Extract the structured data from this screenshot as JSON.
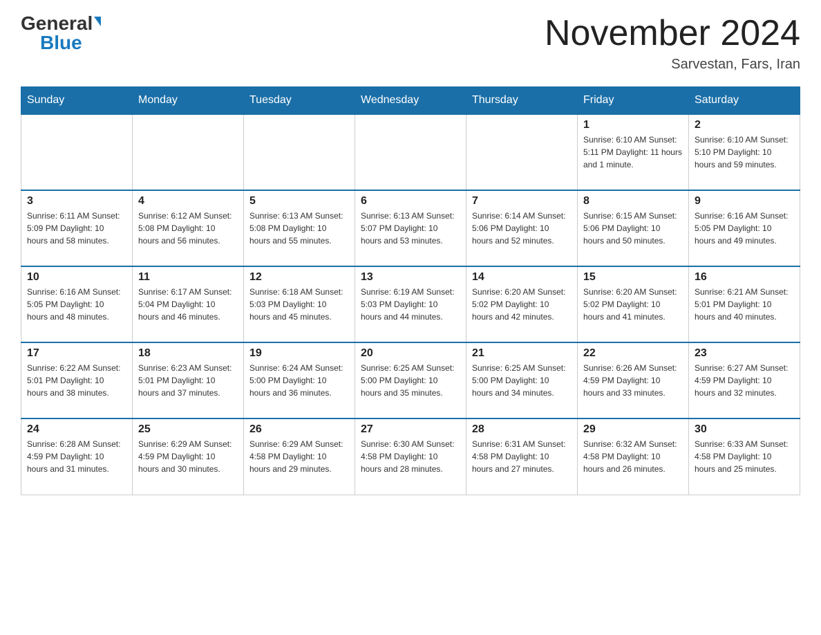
{
  "header": {
    "logo_general": "General",
    "logo_blue": "Blue",
    "month_title": "November 2024",
    "subtitle": "Sarvestan, Fars, Iran"
  },
  "weekdays": [
    "Sunday",
    "Monday",
    "Tuesday",
    "Wednesday",
    "Thursday",
    "Friday",
    "Saturday"
  ],
  "weeks": [
    [
      {
        "day": "",
        "info": ""
      },
      {
        "day": "",
        "info": ""
      },
      {
        "day": "",
        "info": ""
      },
      {
        "day": "",
        "info": ""
      },
      {
        "day": "",
        "info": ""
      },
      {
        "day": "1",
        "info": "Sunrise: 6:10 AM\nSunset: 5:11 PM\nDaylight: 11 hours and 1 minute."
      },
      {
        "day": "2",
        "info": "Sunrise: 6:10 AM\nSunset: 5:10 PM\nDaylight: 10 hours and 59 minutes."
      }
    ],
    [
      {
        "day": "3",
        "info": "Sunrise: 6:11 AM\nSunset: 5:09 PM\nDaylight: 10 hours and 58 minutes."
      },
      {
        "day": "4",
        "info": "Sunrise: 6:12 AM\nSunset: 5:08 PM\nDaylight: 10 hours and 56 minutes."
      },
      {
        "day": "5",
        "info": "Sunrise: 6:13 AM\nSunset: 5:08 PM\nDaylight: 10 hours and 55 minutes."
      },
      {
        "day": "6",
        "info": "Sunrise: 6:13 AM\nSunset: 5:07 PM\nDaylight: 10 hours and 53 minutes."
      },
      {
        "day": "7",
        "info": "Sunrise: 6:14 AM\nSunset: 5:06 PM\nDaylight: 10 hours and 52 minutes."
      },
      {
        "day": "8",
        "info": "Sunrise: 6:15 AM\nSunset: 5:06 PM\nDaylight: 10 hours and 50 minutes."
      },
      {
        "day": "9",
        "info": "Sunrise: 6:16 AM\nSunset: 5:05 PM\nDaylight: 10 hours and 49 minutes."
      }
    ],
    [
      {
        "day": "10",
        "info": "Sunrise: 6:16 AM\nSunset: 5:05 PM\nDaylight: 10 hours and 48 minutes."
      },
      {
        "day": "11",
        "info": "Sunrise: 6:17 AM\nSunset: 5:04 PM\nDaylight: 10 hours and 46 minutes."
      },
      {
        "day": "12",
        "info": "Sunrise: 6:18 AM\nSunset: 5:03 PM\nDaylight: 10 hours and 45 minutes."
      },
      {
        "day": "13",
        "info": "Sunrise: 6:19 AM\nSunset: 5:03 PM\nDaylight: 10 hours and 44 minutes."
      },
      {
        "day": "14",
        "info": "Sunrise: 6:20 AM\nSunset: 5:02 PM\nDaylight: 10 hours and 42 minutes."
      },
      {
        "day": "15",
        "info": "Sunrise: 6:20 AM\nSunset: 5:02 PM\nDaylight: 10 hours and 41 minutes."
      },
      {
        "day": "16",
        "info": "Sunrise: 6:21 AM\nSunset: 5:01 PM\nDaylight: 10 hours and 40 minutes."
      }
    ],
    [
      {
        "day": "17",
        "info": "Sunrise: 6:22 AM\nSunset: 5:01 PM\nDaylight: 10 hours and 38 minutes."
      },
      {
        "day": "18",
        "info": "Sunrise: 6:23 AM\nSunset: 5:01 PM\nDaylight: 10 hours and 37 minutes."
      },
      {
        "day": "19",
        "info": "Sunrise: 6:24 AM\nSunset: 5:00 PM\nDaylight: 10 hours and 36 minutes."
      },
      {
        "day": "20",
        "info": "Sunrise: 6:25 AM\nSunset: 5:00 PM\nDaylight: 10 hours and 35 minutes."
      },
      {
        "day": "21",
        "info": "Sunrise: 6:25 AM\nSunset: 5:00 PM\nDaylight: 10 hours and 34 minutes."
      },
      {
        "day": "22",
        "info": "Sunrise: 6:26 AM\nSunset: 4:59 PM\nDaylight: 10 hours and 33 minutes."
      },
      {
        "day": "23",
        "info": "Sunrise: 6:27 AM\nSunset: 4:59 PM\nDaylight: 10 hours and 32 minutes."
      }
    ],
    [
      {
        "day": "24",
        "info": "Sunrise: 6:28 AM\nSunset: 4:59 PM\nDaylight: 10 hours and 31 minutes."
      },
      {
        "day": "25",
        "info": "Sunrise: 6:29 AM\nSunset: 4:59 PM\nDaylight: 10 hours and 30 minutes."
      },
      {
        "day": "26",
        "info": "Sunrise: 6:29 AM\nSunset: 4:58 PM\nDaylight: 10 hours and 29 minutes."
      },
      {
        "day": "27",
        "info": "Sunrise: 6:30 AM\nSunset: 4:58 PM\nDaylight: 10 hours and 28 minutes."
      },
      {
        "day": "28",
        "info": "Sunrise: 6:31 AM\nSunset: 4:58 PM\nDaylight: 10 hours and 27 minutes."
      },
      {
        "day": "29",
        "info": "Sunrise: 6:32 AM\nSunset: 4:58 PM\nDaylight: 10 hours and 26 minutes."
      },
      {
        "day": "30",
        "info": "Sunrise: 6:33 AM\nSunset: 4:58 PM\nDaylight: 10 hours and 25 minutes."
      }
    ]
  ]
}
